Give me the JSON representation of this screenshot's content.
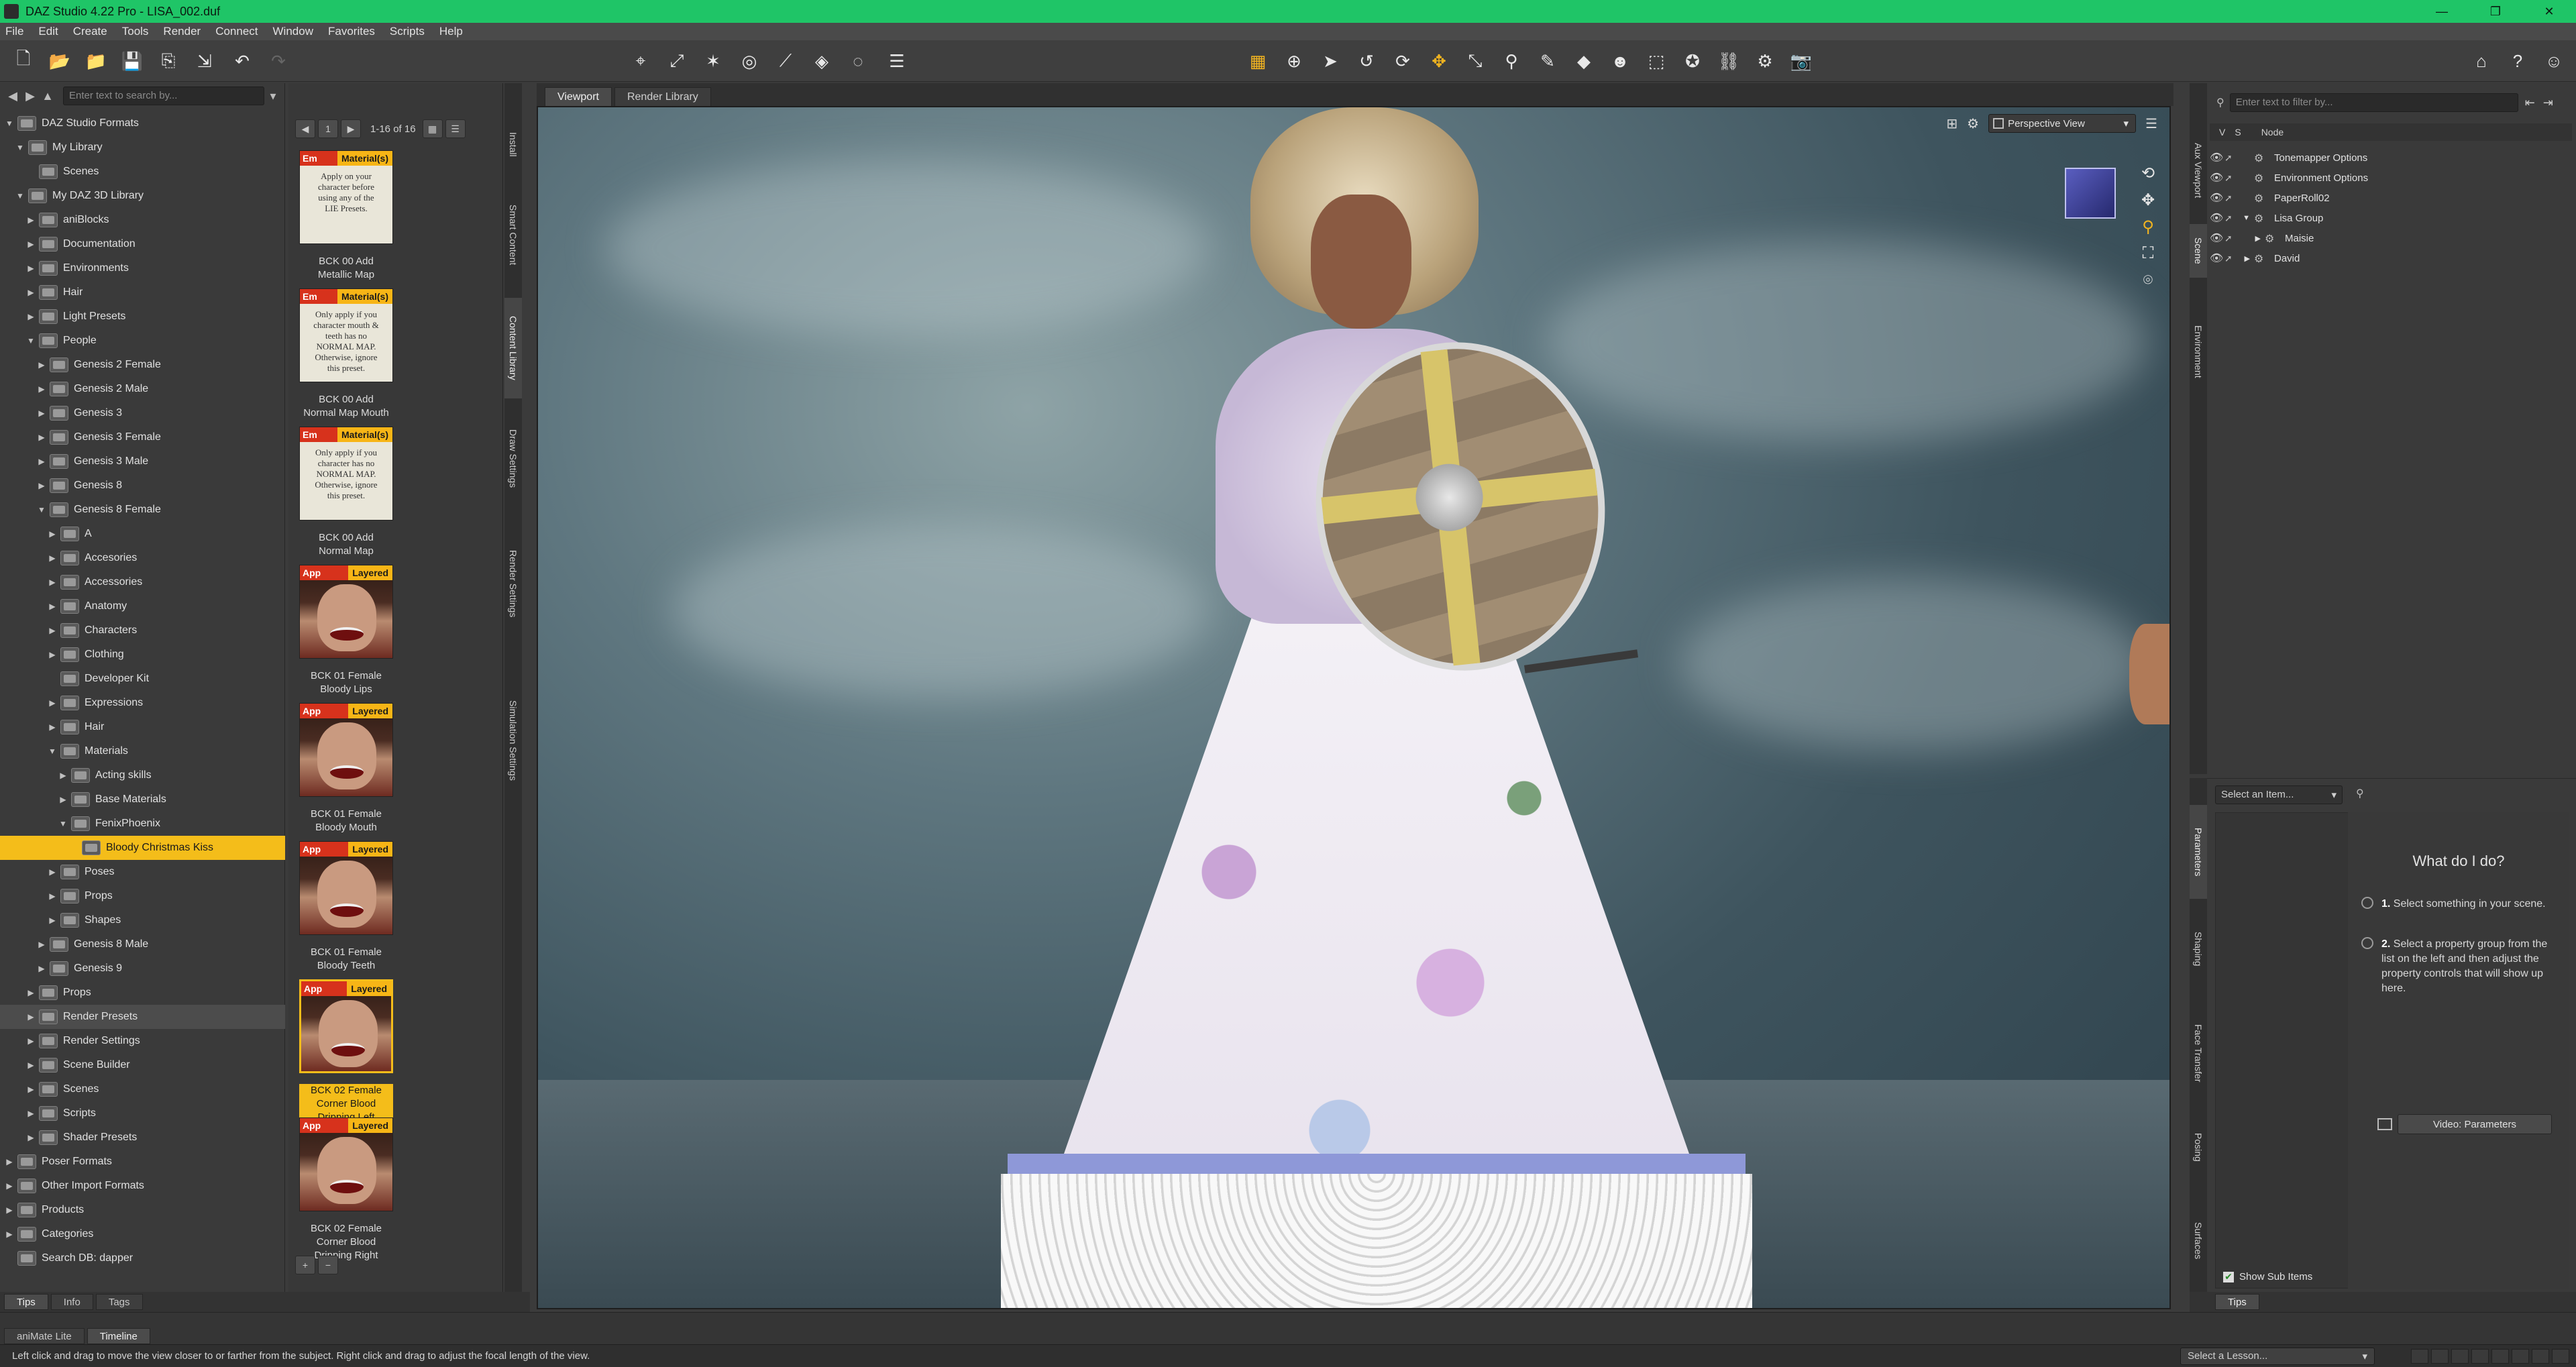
{
  "titlebar": {
    "title": "DAZ Studio 4.22 Pro - LISA_002.duf",
    "minimize": "—",
    "maximize": "❐",
    "close": "✕"
  },
  "menu": [
    "File",
    "Edit",
    "Create",
    "Tools",
    "Render",
    "Connect",
    "Window",
    "Favorites",
    "Scripts",
    "Help"
  ],
  "library": {
    "search_placeholder": "Enter text to search by...",
    "tree": [
      {
        "label": "DAZ Studio Formats",
        "depth": 0,
        "arrow": "▼",
        "icon": "tree"
      },
      {
        "label": "My Library",
        "depth": 1,
        "arrow": "▼"
      },
      {
        "label": "Scenes",
        "depth": 2,
        "arrow": ""
      },
      {
        "label": "My DAZ 3D Library",
        "depth": 1,
        "arrow": "▼"
      },
      {
        "label": "aniBlocks",
        "depth": 2,
        "arrow": "▶"
      },
      {
        "label": "Documentation",
        "depth": 2,
        "arrow": "▶"
      },
      {
        "label": "Environments",
        "depth": 2,
        "arrow": "▶"
      },
      {
        "label": "Hair",
        "depth": 2,
        "arrow": "▶"
      },
      {
        "label": "Light Presets",
        "depth": 2,
        "arrow": "▶"
      },
      {
        "label": "People",
        "depth": 2,
        "arrow": "▼"
      },
      {
        "label": "Genesis 2 Female",
        "depth": 3,
        "arrow": "▶"
      },
      {
        "label": "Genesis 2 Male",
        "depth": 3,
        "arrow": "▶"
      },
      {
        "label": "Genesis 3",
        "depth": 3,
        "arrow": "▶"
      },
      {
        "label": "Genesis 3 Female",
        "depth": 3,
        "arrow": "▶"
      },
      {
        "label": "Genesis 3 Male",
        "depth": 3,
        "arrow": "▶"
      },
      {
        "label": "Genesis 8",
        "depth": 3,
        "arrow": "▶"
      },
      {
        "label": "Genesis 8 Female",
        "depth": 3,
        "arrow": "▼"
      },
      {
        "label": "A",
        "depth": 4,
        "arrow": "▶"
      },
      {
        "label": "Accesories",
        "depth": 4,
        "arrow": "▶"
      },
      {
        "label": "Accessories",
        "depth": 4,
        "arrow": "▶"
      },
      {
        "label": "Anatomy",
        "depth": 4,
        "arrow": "▶"
      },
      {
        "label": "Characters",
        "depth": 4,
        "arrow": "▶"
      },
      {
        "label": "Clothing",
        "depth": 4,
        "arrow": "▶"
      },
      {
        "label": "Developer Kit",
        "depth": 4,
        "arrow": ""
      },
      {
        "label": "Expressions",
        "depth": 4,
        "arrow": "▶"
      },
      {
        "label": "Hair",
        "depth": 4,
        "arrow": "▶"
      },
      {
        "label": "Materials",
        "depth": 4,
        "arrow": "▼"
      },
      {
        "label": "Acting skills",
        "depth": 5,
        "arrow": "▶"
      },
      {
        "label": "Base Materials",
        "depth": 5,
        "arrow": "▶"
      },
      {
        "label": "FenixPhoenix",
        "depth": 5,
        "arrow": "▼"
      },
      {
        "label": "Bloody Christmas Kiss",
        "depth": 6,
        "arrow": "",
        "selected": true
      },
      {
        "label": "Poses",
        "depth": 4,
        "arrow": "▶"
      },
      {
        "label": "Props",
        "depth": 4,
        "arrow": "▶"
      },
      {
        "label": "Shapes",
        "depth": 4,
        "arrow": "▶"
      },
      {
        "label": "Genesis 8 Male",
        "depth": 3,
        "arrow": "▶"
      },
      {
        "label": "Genesis 9",
        "depth": 3,
        "arrow": "▶"
      },
      {
        "label": "Props",
        "depth": 2,
        "arrow": "▶"
      },
      {
        "label": "Render Presets",
        "depth": 2,
        "arrow": "▶",
        "hover": true
      },
      {
        "label": "Render Settings",
        "depth": 2,
        "arrow": "▶"
      },
      {
        "label": "Scene Builder",
        "depth": 2,
        "arrow": "▶"
      },
      {
        "label": "Scenes",
        "depth": 2,
        "arrow": "▶"
      },
      {
        "label": "Scripts",
        "depth": 2,
        "arrow": "▶"
      },
      {
        "label": "Shader Presets",
        "depth": 2,
        "arrow": "▶"
      },
      {
        "label": "Poser Formats",
        "depth": 0,
        "arrow": "▶"
      },
      {
        "label": "Other Import Formats",
        "depth": 0,
        "arrow": "▶"
      },
      {
        "label": "Products",
        "depth": 0,
        "arrow": "▶"
      },
      {
        "label": "Categories",
        "depth": 0,
        "arrow": "▶"
      },
      {
        "label": "Search DB: dapper",
        "depth": 0,
        "arrow": ""
      }
    ]
  },
  "thumbs": {
    "page_count": "1-16 of 16",
    "items": [
      {
        "badge": "Em",
        "badge2": "Material(s)",
        "paper": [
          "Apply on your",
          "character before",
          "using any of the",
          "LIE Presets."
        ],
        "caption": [
          "BCK 00 Add",
          "Metallic Map"
        ],
        "type": "paper"
      },
      {
        "badge": "Em",
        "badge2": "Material(s)",
        "paper": [
          "Only apply if you",
          "character mouth &",
          "teeth has no",
          "NORMAL MAP.",
          "Otherwise, ignore",
          "this preset."
        ],
        "caption": [
          "BCK 00 Add",
          "Normal Map Mouth"
        ],
        "type": "paper"
      },
      {
        "badge": "Em",
        "badge2": "Material(s)",
        "paper": [
          "Only apply if you",
          "character has no",
          "NORMAL MAP.",
          "Otherwise, ignore",
          "this preset."
        ],
        "caption": [
          "BCK 00 Add",
          "Normal Map"
        ],
        "type": "paper"
      },
      {
        "badge": "App",
        "badge2": "Layered",
        "caption": [
          "BCK 01 Female",
          "Bloody Lips"
        ],
        "type": "face"
      },
      {
        "badge": "App",
        "badge2": "Layered",
        "caption": [
          "BCK 01 Female",
          "Bloody Mouth"
        ],
        "type": "face"
      },
      {
        "badge": "App",
        "badge2": "Layered",
        "caption": [
          "BCK 01 Female",
          "Bloody Teeth"
        ],
        "type": "face"
      },
      {
        "badge": "App",
        "badge2": "Layered",
        "caption": [
          "BCK 02 Female",
          "Corner Blood",
          "Dripping Left"
        ],
        "type": "face",
        "selected": true
      },
      {
        "badge": "App",
        "badge2": "Layered",
        "caption": [
          "BCK 02 Female",
          "Corner Blood",
          "Dripping Right"
        ],
        "type": "face"
      }
    ]
  },
  "left_vtabs": [
    "Install",
    "Smart Content",
    "Content Library",
    "Draw Settings",
    "Render Settings",
    "Simulation Settings"
  ],
  "viewport": {
    "tabs": [
      "Viewport",
      "Render Library"
    ],
    "perspective": "Perspective View"
  },
  "scene": {
    "filter_placeholder": "Enter text to filter by...",
    "col_v": "V",
    "col_s": "S",
    "col_node": "Node",
    "nodes": [
      {
        "label": "Tonemapper Options",
        "indent": 0,
        "arrow": ""
      },
      {
        "label": "Environment Options",
        "indent": 0,
        "arrow": ""
      },
      {
        "label": "PaperRoll02",
        "indent": 0,
        "arrow": ""
      },
      {
        "label": "Lisa Group",
        "indent": 0,
        "arrow": "▼"
      },
      {
        "label": "Maisie",
        "indent": 1,
        "arrow": "▶"
      },
      {
        "label": "David",
        "indent": 0,
        "arrow": "▶"
      }
    ]
  },
  "right_vtabs_top": [
    "Aux Viewport",
    "Scene",
    "Environment"
  ],
  "right_vtabs_bottom": [
    "Parameters",
    "Shaping",
    "Face Transfer",
    "Posing",
    "Surfaces"
  ],
  "params": {
    "select_item": "Select an Item...",
    "tips_title": "What do I do?",
    "step1_num": "1.",
    "step1": "Select something in your scene.",
    "step2_num": "2.",
    "step2": "Select a property group from the list on the left and then adjust the property controls that will show up here.",
    "video_button": "Video: Parameters",
    "show_sub_items": "Show Sub Items"
  },
  "bottom": {
    "left_tabs": [
      "Tips",
      "Info",
      "Tags"
    ],
    "right_tab": "Tips",
    "timeline_tabs": [
      "aniMate Lite",
      "Timeline"
    ],
    "status": "Left click and drag to move the view closer to or farther from the subject. Right click and drag to adjust the focal length of the view.",
    "lesson": "Select a Lesson..."
  }
}
